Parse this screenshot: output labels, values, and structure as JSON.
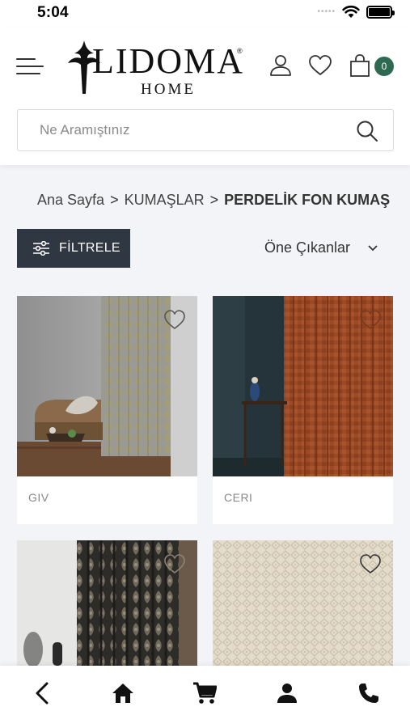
{
  "status_bar": {
    "time": "5:04",
    "signal": "•••••"
  },
  "header": {
    "logo_main": "LIDOMA",
    "logo_sub": "HOME",
    "logo_reg": "®",
    "cart_count": "0",
    "accent_color": "#2e6a52"
  },
  "search": {
    "placeholder": "Ne Aramıştınız"
  },
  "breadcrumb": {
    "items": [
      "Ana Sayfa",
      "KUMAŞLAR",
      "PERDELİK FON KUMAŞ"
    ],
    "separator": ">"
  },
  "toolbar": {
    "filter_label": "FİLTRELE",
    "sort_label": "Öne Çıkanlar"
  },
  "products": [
    {
      "name": "GIV"
    },
    {
      "name": "CERI"
    },
    {
      "name": ""
    },
    {
      "name": ""
    }
  ],
  "bottom_nav": {
    "items": [
      "back-icon",
      "home-icon",
      "cart-icon",
      "account-icon",
      "phone-icon"
    ]
  }
}
